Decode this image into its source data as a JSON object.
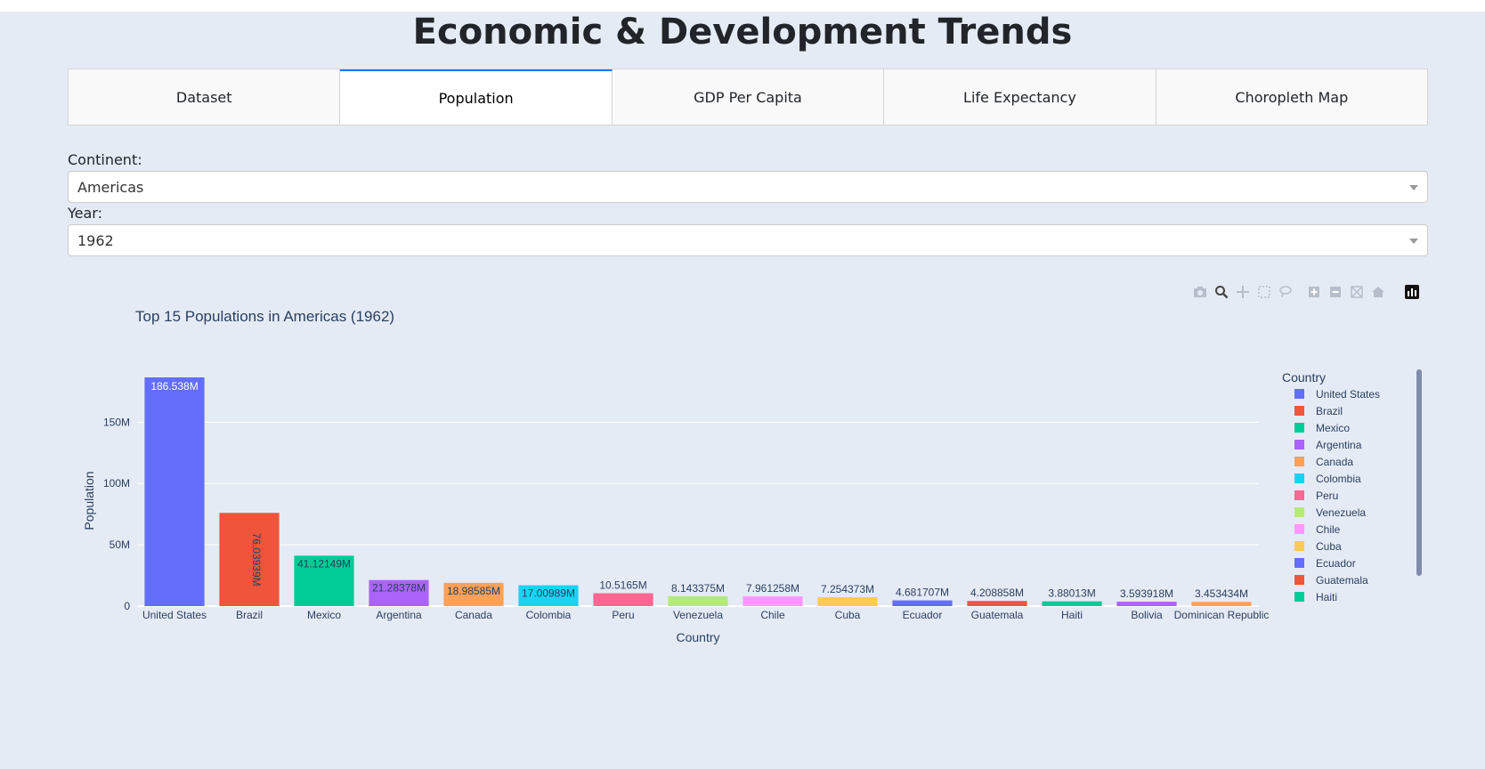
{
  "page": {
    "title": "Economic & Development Trends"
  },
  "tabs": [
    {
      "label": "Dataset",
      "active": false
    },
    {
      "label": "Population",
      "active": true
    },
    {
      "label": "GDP Per Capita",
      "active": false
    },
    {
      "label": "Life Expectancy",
      "active": false
    },
    {
      "label": "Choropleth Map",
      "active": false
    }
  ],
  "filters": {
    "continent_label": "Continent:",
    "continent_value": "Americas",
    "year_label": "Year:",
    "year_value": "1962"
  },
  "modebar": {
    "icons": [
      "camera-icon",
      "zoom-icon",
      "pan-icon",
      "box-select-icon",
      "lasso-select-icon",
      "zoom-in-icon",
      "zoom-out-icon",
      "autoscale-icon",
      "reset-axes-icon",
      "plotly-logo-icon"
    ]
  },
  "chart_data": {
    "type": "bar",
    "title": "Top 15 Populations in Americas (1962)",
    "xlabel": "Country",
    "ylabel": "Population",
    "legend_title": "Country",
    "legend_position": "right",
    "ylim": [
      0,
      186538000
    ],
    "yticks": [
      0,
      50000000,
      100000000,
      150000000
    ],
    "ytick_labels": [
      "0",
      "50M",
      "100M",
      "150M"
    ],
    "grid": true,
    "categories": [
      "United States",
      "Brazil",
      "Mexico",
      "Argentina",
      "Canada",
      "Colombia",
      "Peru",
      "Venezuela",
      "Chile",
      "Cuba",
      "Ecuador",
      "Guatemala",
      "Haiti",
      "Bolivia",
      "Dominican Republic"
    ],
    "values": [
      186538000,
      76039390,
      41121485,
      21283783,
      18985849,
      17009885,
      10516500,
      8143375,
      7961258,
      7254373,
      4681707,
      4208858,
      3880130,
      3593918,
      3453434
    ],
    "labels": [
      "186.538M",
      "76.03939M",
      "41.12149M",
      "21.28378M",
      "18.98585M",
      "17.00989M",
      "10.5165M",
      "8.143375M",
      "7.961258M",
      "7.254373M",
      "4.681707M",
      "4.208858M",
      "3.88013M",
      "3.593918M",
      "3.453434M"
    ],
    "colors": [
      "#636efa",
      "#ef553b",
      "#00cc96",
      "#ab63fa",
      "#ffa15a",
      "#19d3f3",
      "#ff6692",
      "#b6e880",
      "#ff97ff",
      "#fecb52",
      "#636efa",
      "#ef553b",
      "#00cc96",
      "#ab63fa",
      "#ffa15a"
    ],
    "legend_visible": [
      "United States",
      "Brazil",
      "Mexico",
      "Argentina",
      "Canada",
      "Colombia",
      "Peru",
      "Venezuela",
      "Chile",
      "Cuba",
      "Ecuador",
      "Guatemala",
      "Haiti"
    ]
  }
}
